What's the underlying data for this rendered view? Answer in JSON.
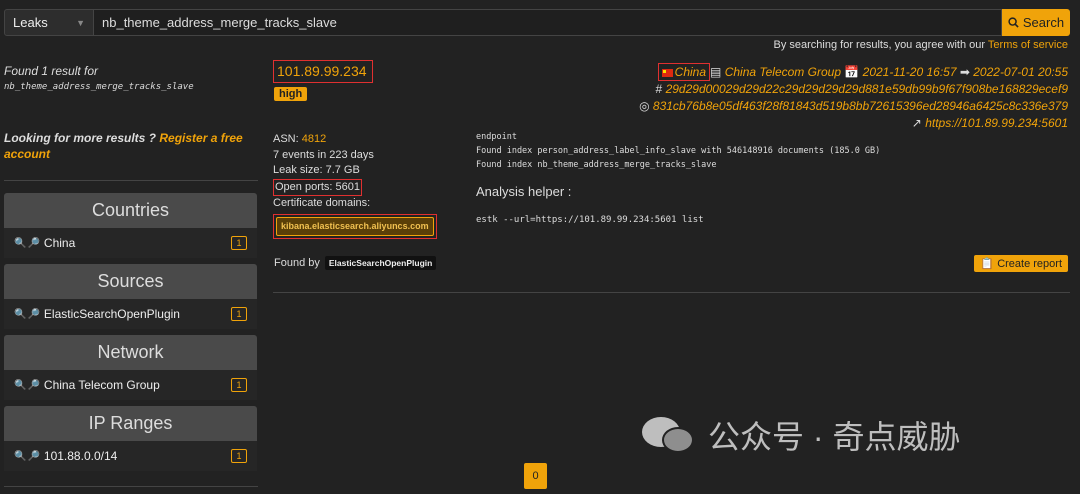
{
  "search": {
    "category": "Leaks",
    "query": "nb_theme_address_merge_tracks_slave",
    "button": "Search",
    "terms_prefix": "By searching for results, you agree with our",
    "terms_link": "Terms of service"
  },
  "sidebar": {
    "found_text": "Found 1 result for",
    "found_query": "nb_theme_address_merge_tracks_slave",
    "more_prefix": "Looking for more results ?",
    "more_link": "Register a free account",
    "facets": [
      {
        "title": "Countries",
        "item": "China",
        "count": "1"
      },
      {
        "title": "Sources",
        "item": "ElasticSearchOpenPlugin",
        "count": "1"
      },
      {
        "title": "Network",
        "item": "China Telecom Group",
        "count": "1"
      },
      {
        "title": "IP Ranges",
        "item": "101.88.0.0/14",
        "count": "1"
      }
    ]
  },
  "result": {
    "ip": "101.89.99.234",
    "severity": "high",
    "country": "China",
    "isp": "China Telecom Group",
    "first_seen": "2021-11-20 16:57",
    "last_seen": "2022-07-01 20:55",
    "hash1": "29d29d00029d29d22c29d29d29d29d881e59db99b9f67f908be168829ecef9",
    "hash2": "831cb76b8e05df463f28f81843d519b8bb72615396ed28946a6425c8c336e379",
    "url": "https://101.89.99.234:5601",
    "asn_label": "ASN:",
    "asn": "4812",
    "events": "7 events in 223 days",
    "leak_size": "Leak size: 7.7 GB",
    "open_ports": "Open ports: 5601",
    "cert_label": "Certificate domains:",
    "cert_domain": "kibana.elasticsearch.aliyuncs.com",
    "log_lines": [
      "endpoint",
      "Found index person_address_label_info_slave with 546148916 documents (185.0 GB)",
      "Found index nb_theme_address_merge_tracks_slave"
    ],
    "helper_title": "Analysis helper :",
    "helper_cmd": "estk --url=https://101.89.99.234:5601 list",
    "found_by_label": "Found by",
    "found_by_plugin": "ElasticSearchOpenPlugin",
    "report_button": "Create report"
  },
  "watermark": "公众号 · 奇点威胁",
  "pagination": {
    "current": "0"
  },
  "colors": {
    "accent": "#f0a30a",
    "background": "#222222",
    "highlight_box": "#e03030"
  },
  "icons": [
    "search-icon",
    "chevron-down-icon",
    "zoom-in-icon",
    "zoom-out-icon",
    "china-flag-icon",
    "calendar-icon",
    "arrow-circle-icon",
    "hash-icon",
    "fingerprint-icon",
    "external-link-icon",
    "report-icon",
    "wechat-icon"
  ]
}
